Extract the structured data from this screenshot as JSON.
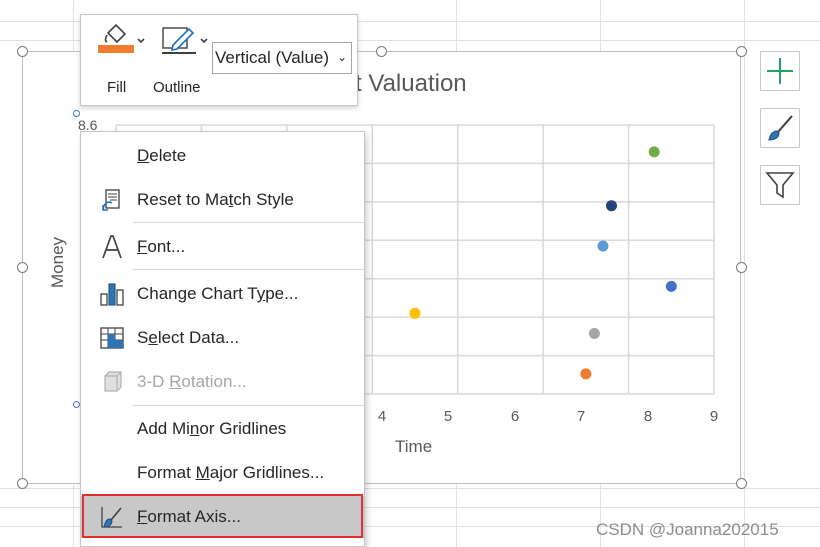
{
  "toolbar": {
    "fill_label": "Fill",
    "outline_label": "Outline",
    "element_selector_value": "Vertical (Value)"
  },
  "chart": {
    "title_visible": "t Valuation",
    "xlabel": "Time",
    "ylabel": "Money",
    "y_top_tick": "8.6",
    "x_ticks": [
      "4",
      "5",
      "6",
      "7",
      "8",
      "9"
    ]
  },
  "chart_data": {
    "type": "scatter",
    "title": "t Valuation",
    "xlabel": "Time",
    "ylabel": "Money",
    "xlim": [
      2,
      9
    ],
    "points": [
      {
        "x": 8.3,
        "y": 8.4,
        "color": "#70ad47"
      },
      {
        "x": 7.8,
        "y": 8.0,
        "color": "#264478"
      },
      {
        "x": 7.7,
        "y": 7.7,
        "color": "#5b9bd5"
      },
      {
        "x": 8.5,
        "y": 7.4,
        "color": "#4472c4"
      },
      {
        "x": 5.5,
        "y": 7.2,
        "color": "#ffc000"
      },
      {
        "x": 7.6,
        "y": 7.05,
        "color": "#a5a5a5"
      },
      {
        "x": 7.5,
        "y": 6.75,
        "color": "#ed7d31"
      }
    ]
  },
  "context_menu": {
    "items": [
      {
        "pre": "",
        "u": "D",
        "post": "elete"
      },
      {
        "pre": "Reset to Ma",
        "u": "t",
        "post": "ch Style"
      },
      {
        "pre": "",
        "u": "F",
        "post": "ont..."
      },
      {
        "pre": "Change Chart T",
        "u": "y",
        "post": "pe..."
      },
      {
        "pre": "S",
        "u": "e",
        "post": "lect Data..."
      },
      {
        "pre": "3-D ",
        "u": "R",
        "post": "otation..."
      },
      {
        "pre": "Add Mi",
        "u": "n",
        "post": "or Gridlines"
      },
      {
        "pre": "Format ",
        "u": "M",
        "post": "ajor Gridlines..."
      },
      {
        "pre": "",
        "u": "F",
        "post": "ormat Axis..."
      }
    ]
  },
  "side_buttons": {
    "chart_elements": "plus-icon",
    "chart_styles": "brush-icon",
    "chart_filters": "funnel-icon"
  },
  "watermark": "CSDN @Joanna202015",
  "colors": {
    "highlight_box": "#e0312e",
    "fill_accent": "#ed7d31",
    "hover": "#c8c8c8"
  }
}
